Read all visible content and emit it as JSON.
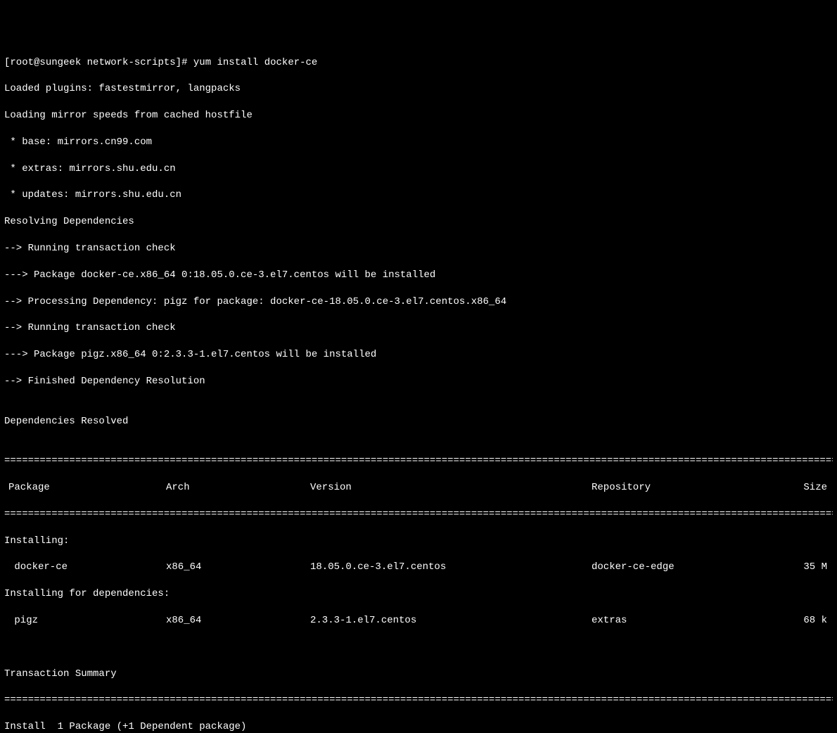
{
  "prompt": {
    "user": "root",
    "host": "sungeek",
    "cwd": "network-scripts",
    "symbol": "#",
    "command": "yum install docker-ce"
  },
  "preamble": [
    "Loaded plugins: fastestmirror, langpacks",
    "Loading mirror speeds from cached hostfile",
    " * base: mirrors.cn99.com",
    " * extras: mirrors.shu.edu.cn",
    " * updates: mirrors.shu.edu.cn",
    "Resolving Dependencies",
    "--> Running transaction check",
    "---> Package docker-ce.x86_64 0:18.05.0.ce-3.el7.centos will be installed",
    "--> Processing Dependency: pigz for package: docker-ce-18.05.0.ce-3.el7.centos.x86_64",
    "--> Running transaction check",
    "---> Package pigz.x86_64 0:2.3.3-1.el7.centos will be installed",
    "--> Finished Dependency Resolution",
    "",
    "Dependencies Resolved",
    ""
  ],
  "table": {
    "headers": {
      "package": "Package",
      "arch": "Arch",
      "version": "Version",
      "repository": "Repository",
      "size": "Size"
    },
    "section_install": "Installing:",
    "section_deps": "Installing for dependencies:",
    "rows": [
      {
        "package": " docker-ce",
        "arch": "x86_64",
        "version": "18.05.0.ce-3.el7.centos",
        "repository": "docker-ce-edge",
        "size": "35 M"
      },
      {
        "package": " pigz",
        "arch": "x86_64",
        "version": "2.3.3-1.el7.centos",
        "repository": "extras",
        "size": "68 k"
      }
    ]
  },
  "summary": {
    "title": "Transaction Summary",
    "install_line": "Install  1 Package (+1 Dependent package)"
  },
  "divider": "============================================================================================================================================="
}
